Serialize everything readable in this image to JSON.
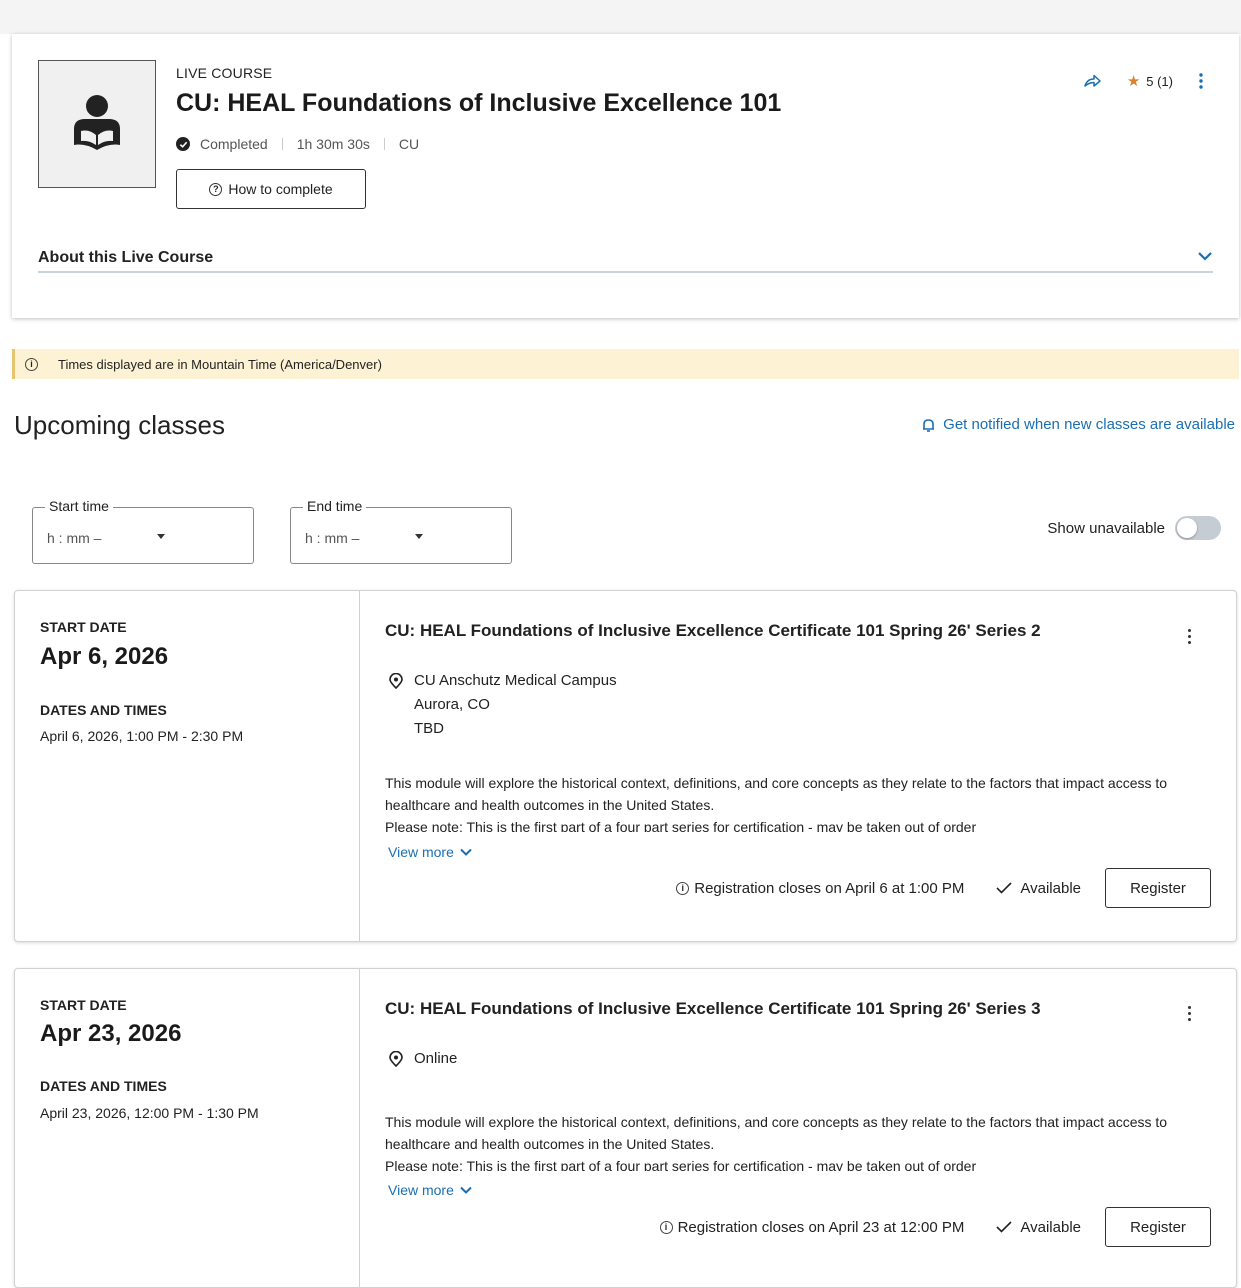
{
  "course": {
    "type": "LIVE COURSE",
    "title": "CU: HEAL Foundations of Inclusive Excellence 101",
    "status": "Completed",
    "duration": "1h 30m 30s",
    "provider": "CU",
    "how_to_complete": "How to complete",
    "rating": "5 (1)",
    "about_label": "About this Live Course",
    "accent_color": "#1a6fb3",
    "star_color": "#d9822b"
  },
  "banner": {
    "timezone_text": "Times displayed are in Mountain Time (America/Denver)"
  },
  "upcoming": {
    "heading": "Upcoming classes",
    "notify_link": "Get notified when new classes are available"
  },
  "filters": {
    "start_label": "Start time",
    "start_value": "h  : mm  –",
    "end_label": "End time",
    "end_value": "h  : mm  –",
    "show_unavailable": "Show unavailable",
    "show_unavailable_on": false
  },
  "classes": [
    {
      "start_label": "START DATE",
      "start_date": "Apr 6, 2026",
      "dt_label": "DATES AND TIMES",
      "dt_text": "April 6, 2026, 1:00 PM - 2:30 PM",
      "title": "CU: HEAL Foundations of Inclusive Excellence Certificate 101 Spring 26' Series 2",
      "location": [
        "CU Anschutz Medical Campus",
        "Aurora, CO",
        "TBD"
      ],
      "description": "This module will explore the historical context, definitions, and core concepts as they relate to the factors that impact access to healthcare and health outcomes in the United States.",
      "note": "Please note: This is the first part of a four part series for certification - may be taken out of order",
      "view_more": "View more",
      "closes": "Registration closes on April 6 at 1:00 PM",
      "availability": "Available",
      "register": "Register"
    },
    {
      "start_label": "START DATE",
      "start_date": "Apr 23, 2026",
      "dt_label": "DATES AND TIMES",
      "dt_text": "April 23, 2026, 12:00 PM - 1:30 PM",
      "title": "CU: HEAL Foundations of Inclusive Excellence Certificate 101 Spring 26' Series 3",
      "location": [
        "Online"
      ],
      "description": "This module will explore the historical context, definitions, and core concepts as they relate to the factors that impact access to healthcare and health outcomes in the United States.",
      "note": "Please note: This is the first part of a four part series for certification - may be taken out of order",
      "view_more": "View more",
      "closes": "Registration closes on April 23 at 12:00 PM",
      "availability": "Available",
      "register": "Register"
    }
  ]
}
